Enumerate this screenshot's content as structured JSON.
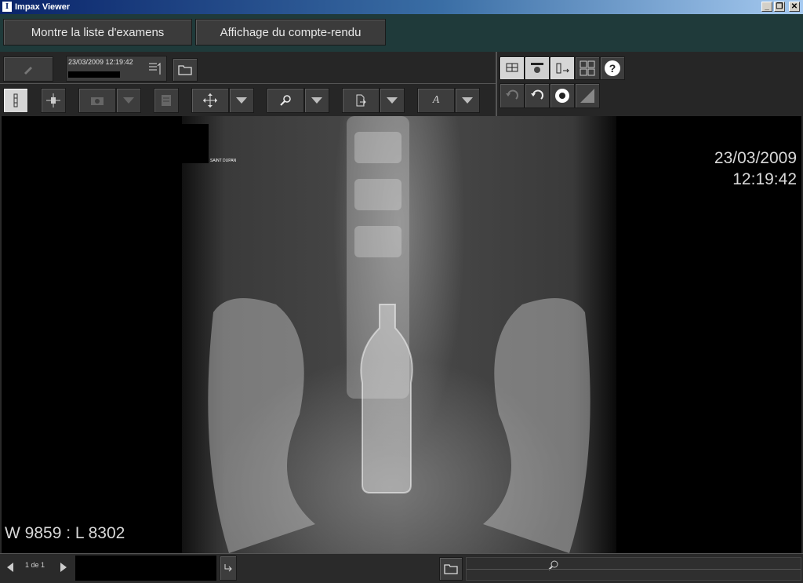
{
  "window": {
    "title": "Impax Viewer",
    "controls": {
      "minimize": "_",
      "restore": "❐",
      "close": "✕"
    }
  },
  "nav": {
    "exam_list_label": "Montre la liste d'examens",
    "report_label": "Affichage du compte-rendu"
  },
  "study": {
    "date_time": "23/03/2009  12:19:42"
  },
  "viewer": {
    "overlay_date": "23/03/2009",
    "overlay_time": "12:19:42",
    "window_level": "W 9859 : L 8302",
    "image_label": "SAINT DUPAN"
  },
  "toolbar": {
    "annotate_glyph": "A"
  },
  "footer": {
    "page_indicator": "1 de 1"
  }
}
